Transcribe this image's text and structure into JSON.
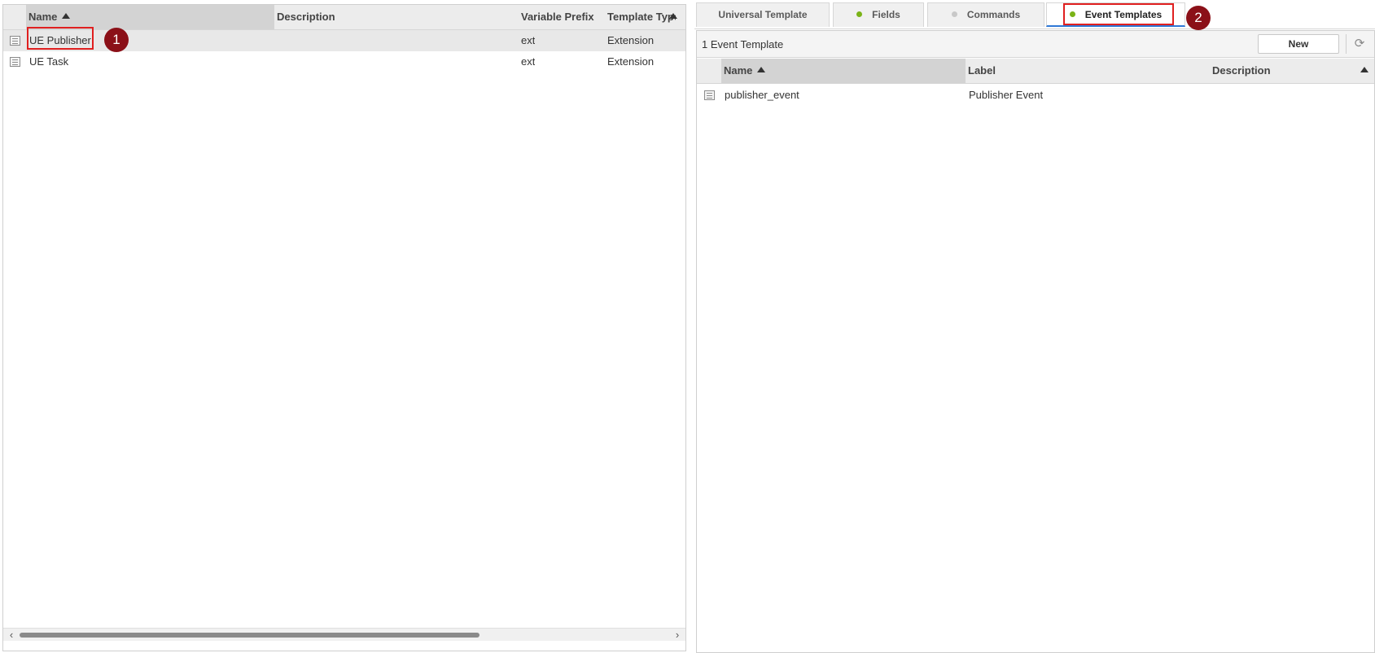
{
  "left_table": {
    "columns": [
      "Name",
      "Description",
      "Variable Prefix",
      "Template Type"
    ],
    "rows": [
      {
        "name": "UE Publisher",
        "description": "",
        "prefix": "ext",
        "type": "Extension"
      },
      {
        "name": "UE Task",
        "description": "",
        "prefix": "ext",
        "type": "Extension"
      }
    ],
    "scroll_left": "‹",
    "scroll_right": "›"
  },
  "tabs": [
    {
      "label": "Universal Template",
      "dot_color": null
    },
    {
      "label": "Fields",
      "dot_color": "#7ab317"
    },
    {
      "label": "Commands",
      "dot_color": "#c8c8c8"
    },
    {
      "label": "Event Templates",
      "dot_color": "#7ab317",
      "active": true
    }
  ],
  "right_panel": {
    "count_label": "1 Event Template",
    "new_button": "New",
    "refresh_icon": "⟳",
    "columns": [
      "Name",
      "Label",
      "Description"
    ],
    "rows": [
      {
        "name": "publisher_event",
        "label": "Publisher Event",
        "description": ""
      }
    ]
  },
  "annotations": {
    "badge1": "1",
    "badge2": "2",
    "highlight_color": "#e02020",
    "badge_color": "#8b1018"
  }
}
